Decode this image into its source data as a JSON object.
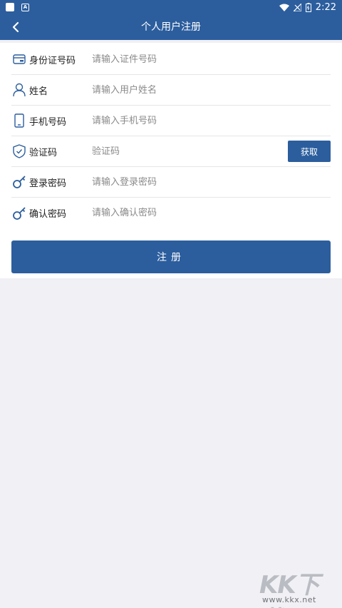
{
  "status_bar": {
    "time": "2:22"
  },
  "header": {
    "title": "个人用户注册"
  },
  "form": {
    "rows": [
      {
        "label": "身份证号码",
        "placeholder": "请输入证件号码",
        "icon": "id-card-icon"
      },
      {
        "label": "姓名",
        "placeholder": "请输入用户姓名",
        "icon": "user-icon"
      },
      {
        "label": "手机号码",
        "placeholder": "请输入手机号码",
        "icon": "phone-icon"
      },
      {
        "label": "验证码",
        "placeholder": "验证码",
        "icon": "shield-check-icon"
      },
      {
        "label": "登录密码",
        "placeholder": "请输入登录密码",
        "icon": "key-icon"
      },
      {
        "label": "确认密码",
        "placeholder": "请输入确认密码",
        "icon": "key-icon"
      }
    ],
    "get_code_label": "获取",
    "submit_label": "注册"
  },
  "watermark": {
    "brand": "KK下载",
    "url": "www.kkx.net"
  },
  "colors": {
    "primary": "#2c5e9e",
    "background": "#f0f0f5"
  }
}
